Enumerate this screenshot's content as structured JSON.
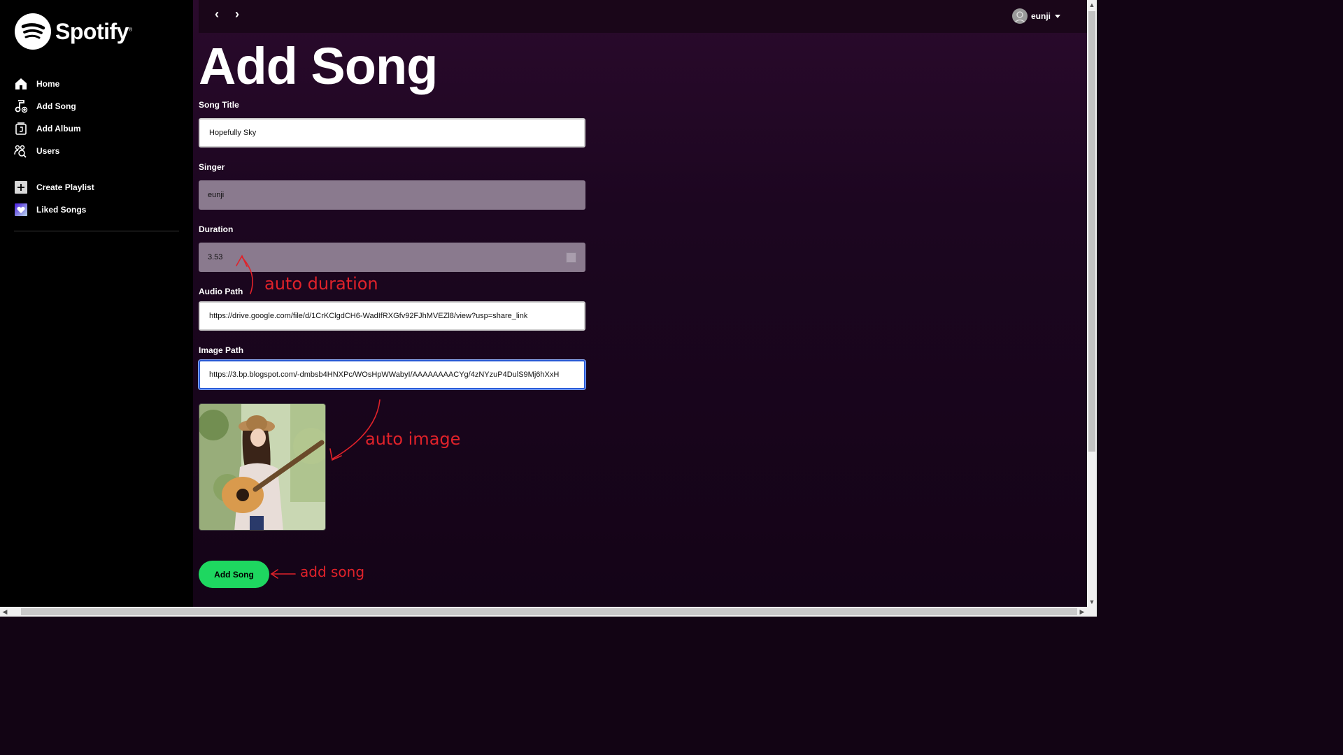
{
  "app": {
    "brand": "Spotify",
    "brand_mark": "®"
  },
  "sidebar": {
    "items": [
      {
        "label": "Home",
        "icon": "home-icon"
      },
      {
        "label": "Add Song",
        "icon": "music-note-add-icon"
      },
      {
        "label": "Add Album",
        "icon": "album-add-icon"
      },
      {
        "label": "Users",
        "icon": "users-icon"
      }
    ],
    "secondary": [
      {
        "label": "Create Playlist",
        "icon": "plus-square-icon"
      },
      {
        "label": "Liked Songs",
        "icon": "heart-icon"
      }
    ]
  },
  "topbar": {
    "back": "‹",
    "forward": "›",
    "username": "eunji"
  },
  "page": {
    "title": "Add Song"
  },
  "form": {
    "song_title": {
      "label": "Song Title",
      "value": "Hopefully Sky"
    },
    "singer": {
      "label": "Singer",
      "value": "eunji"
    },
    "duration": {
      "label": "Duration",
      "value": "3.53"
    },
    "audio_path": {
      "label": "Audio Path",
      "value": "https://drive.google.com/file/d/1CrKClgdCH6-WadIfRXGfv92FJhMVEZl8/view?usp=share_link"
    },
    "image_path": {
      "label": "Image Path",
      "value": "https://3.bp.blogspot.com/-dmbsb4HNXPc/WOsHpWWabyI/AAAAAAAACYg/4zNYzuP4DulS9Mj6hXxH"
    },
    "submit_label": "Add Song"
  },
  "annotations": {
    "duration": "auto duration",
    "image": "auto image",
    "submit": "add song"
  },
  "colors": {
    "accent_green": "#1ed760",
    "annotation_red": "#e0222a",
    "focus_blue": "#2a5bd7"
  }
}
